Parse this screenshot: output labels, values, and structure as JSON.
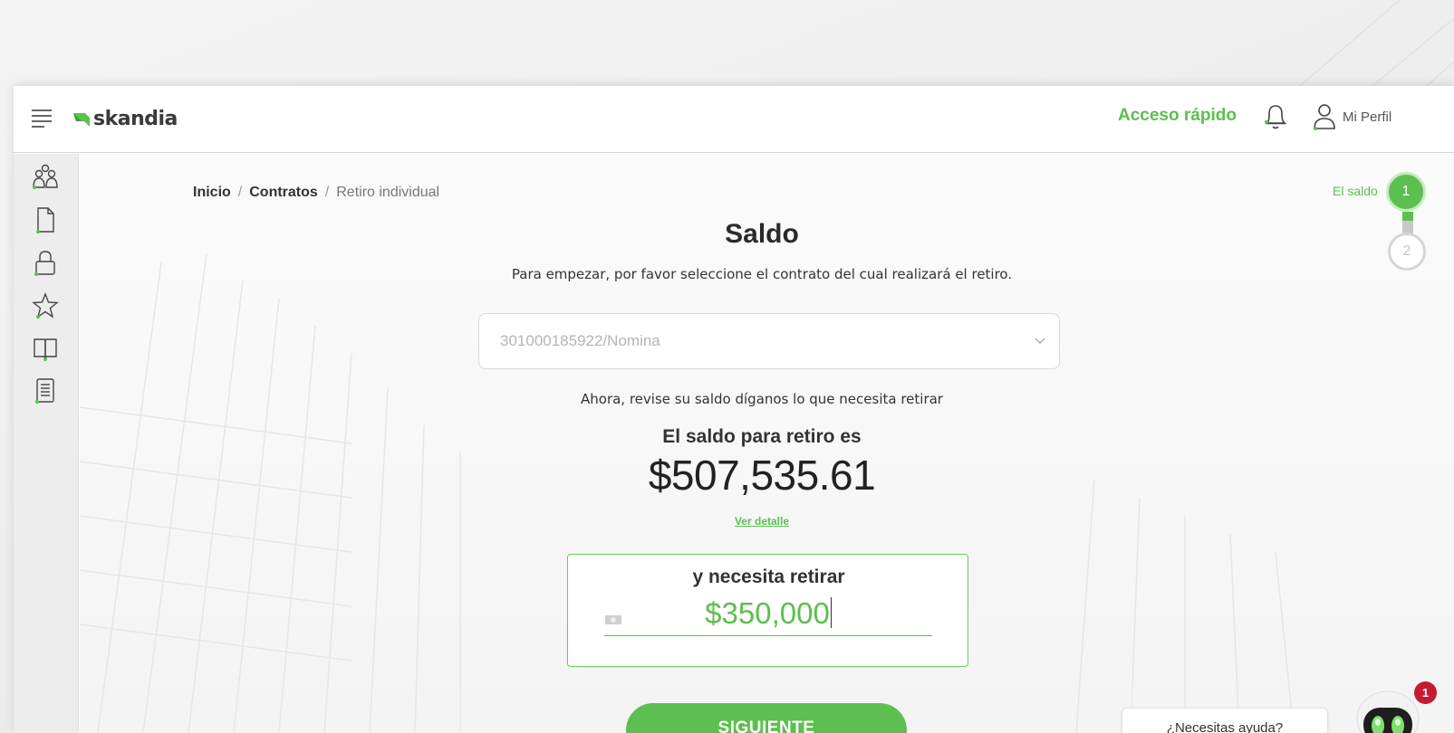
{
  "header": {
    "logo_text": "skandia",
    "quick_access_label": "Acceso rápido",
    "profile_label": "Mi Perfil",
    "icons": [
      "menu-icon",
      "bell-icon",
      "user-icon"
    ]
  },
  "sidebar": {
    "items": [
      {
        "icon": "people-icon"
      },
      {
        "icon": "document-icon"
      },
      {
        "icon": "lock-icon"
      },
      {
        "icon": "star-icon"
      },
      {
        "icon": "book-icon"
      },
      {
        "icon": "notebook-icon"
      }
    ]
  },
  "breadcrumb": {
    "home": "Inicio",
    "contracts": "Contratos",
    "current": "Retiro individual",
    "separator": "/"
  },
  "stepper": {
    "active_label": "El saldo",
    "step1": "1",
    "step2": "2"
  },
  "main": {
    "title": "Saldo",
    "subtitle": "Para empezar, por favor seleccione el contrato del cual realizará el retiro.",
    "contract_select_value": "301000185922/Nomina",
    "instruction": "Ahora, revise su saldo díganos lo que necesita retirar",
    "balance_label": "El saldo para retiro es",
    "balance_amount": "$507,535.61",
    "detail_link": "Ver detalle",
    "withdraw_label": "y necesita retirar",
    "withdraw_value": "$350,000",
    "next_button": "SIGUIENTE"
  },
  "assistant": {
    "help_text": "¿Necesitas ayuda?",
    "badge_count": "1"
  },
  "colors": {
    "accent": "#5cbf4f",
    "badge": "#c51b32",
    "text": "#333333"
  }
}
